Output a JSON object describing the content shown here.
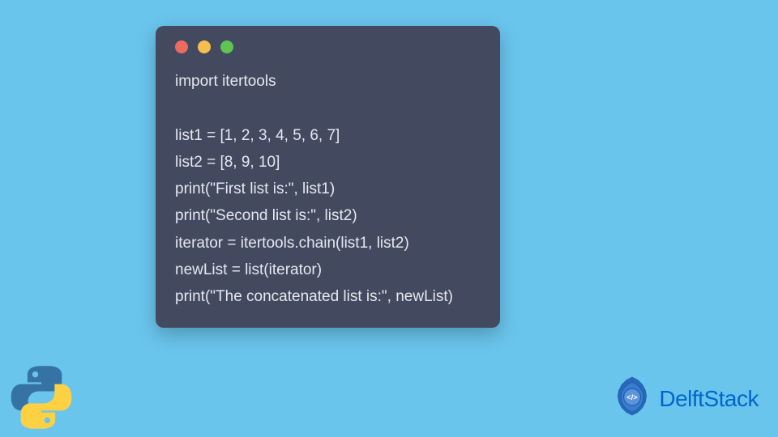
{
  "code": {
    "lines": [
      "import itertools",
      "",
      "list1 = [1, 2, 3, 4, 5, 6, 7]",
      "list2 = [8, 9, 10]",
      "print(\"First list is:\", list1)",
      "print(\"Second list is:\", list2)",
      "iterator = itertools.chain(list1, list2)",
      "newList = list(iterator)",
      "print(\"The concatenated list is:\", newList)"
    ]
  },
  "branding": {
    "delftstack_label": "DelftStack"
  },
  "colors": {
    "background": "#6ac5ed",
    "window_bg": "#434A5F",
    "code_text": "#E6E8F0",
    "brand_text": "#0066CC",
    "traffic_red": "#ED6A5E",
    "traffic_yellow": "#F6BE4F",
    "traffic_green": "#60C453"
  }
}
